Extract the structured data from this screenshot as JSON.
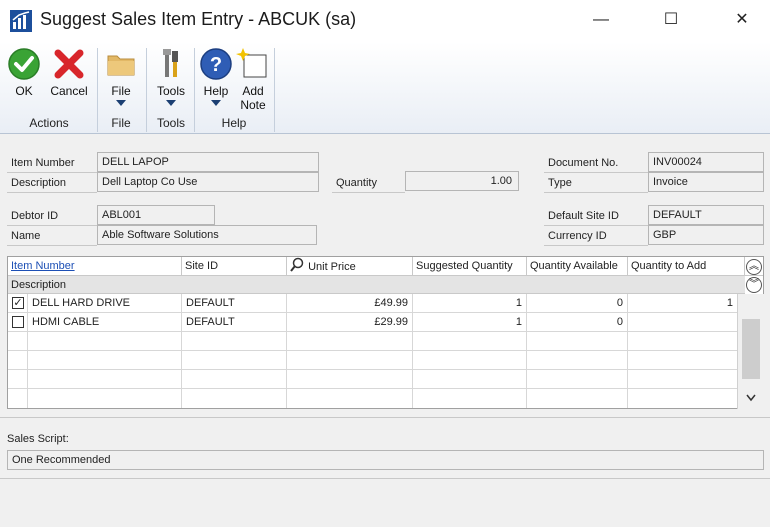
{
  "window": {
    "title": "Suggest Sales Item Entry  -  ABCUK (sa)",
    "controls": {
      "minimize": "—",
      "maximize": "☐",
      "close": "✕"
    }
  },
  "ribbon": {
    "ok": "OK",
    "cancel": "Cancel",
    "file": "File",
    "tools": "Tools",
    "help": "Help",
    "add_note_1": "Add",
    "add_note_2": "Note",
    "groups": {
      "actions": "Actions",
      "file": "File",
      "tools": "Tools",
      "help": "Help"
    }
  },
  "form": {
    "item_number": {
      "label": "Item Number",
      "value": "DELL LAPOP"
    },
    "description": {
      "label": "Description",
      "value": "Dell Laptop Co Use"
    },
    "quantity": {
      "label": "Quantity",
      "value": "1.00"
    },
    "document_no": {
      "label": "Document No.",
      "value": "INV00024"
    },
    "type": {
      "label": "Type",
      "value": "Invoice"
    },
    "debtor_id": {
      "label": "Debtor ID",
      "value": "ABL001"
    },
    "name": {
      "label": "Name",
      "value": "Able Software Solutions"
    },
    "default_site_id": {
      "label": "Default Site ID",
      "value": "DEFAULT"
    },
    "currency_id": {
      "label": "Currency ID",
      "value": "GBP"
    }
  },
  "grid": {
    "headers": {
      "item_number": "Item Number",
      "site_id": "Site ID",
      "unit_price": "Unit Price",
      "suggested_qty": "Suggested Quantity",
      "qty_available": "Quantity Available",
      "qty_to_add": "Quantity to Add"
    },
    "subheader": "Description",
    "rows": [
      {
        "checked": "✓",
        "item": "DELL HARD DRIVE",
        "site": "DEFAULT",
        "price": "£49.99",
        "suggested": "1",
        "available": "0",
        "to_add": "1"
      },
      {
        "checked": "",
        "item": "HDMI CABLE",
        "site": "DEFAULT",
        "price": "£29.99",
        "suggested": "1",
        "available": "0",
        "to_add": ""
      }
    ]
  },
  "sales_script": {
    "label": "Sales Script:",
    "value": "One Recommended"
  },
  "colors": {
    "accent": "#1c4f9c",
    "ok_green": "#3aa335",
    "cancel_red": "#d8262b",
    "link": "#1c4fb5"
  }
}
